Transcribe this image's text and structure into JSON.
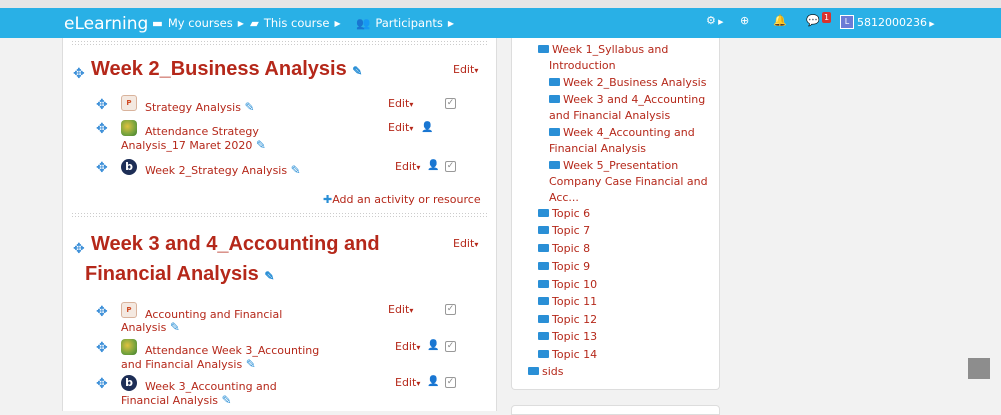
{
  "navbar": {
    "brand": "eLearning",
    "my_courses": "My courses",
    "this_course": "This course",
    "participants": "Participants",
    "messages_badge": "1",
    "user_initial": "L",
    "user_id": "5812000236"
  },
  "sections": [
    {
      "title": "Week 2_Business Analysis",
      "edit_label": "Edit",
      "activities": [
        {
          "name": "Strategy Analysis",
          "edit_label": "Edit",
          "icon": "powerpoint-icon"
        },
        {
          "name_line1": "Attendance Strategy",
          "name_line2": "Analysis_17 Maret 2020",
          "edit_label": "Edit",
          "icon": "attendance-icon"
        },
        {
          "name": "Week 2_Strategy Analysis",
          "edit_label": "Edit",
          "icon": "bigbluebutton-icon"
        }
      ],
      "add_activity": "Add an activity or resource"
    },
    {
      "title_line1": "Week 3 and 4_Accounting and",
      "title_line2": "Financial Analysis",
      "edit_label": "Edit",
      "activities": [
        {
          "name_line1": "Accounting and Financial",
          "name_line2": "Analysis",
          "edit_label": "Edit",
          "icon": "powerpoint-icon"
        },
        {
          "name_line1": "Attendance Week 3_Accounting",
          "name_line2": "and Financial Analysis",
          "edit_label": "Edit",
          "icon": "attendance-icon"
        },
        {
          "name_line1": "Week 3_Accounting and",
          "name_line2": "Financial Analysis",
          "edit_label": "Edit",
          "icon": "bigbluebutton-icon"
        }
      ]
    }
  ],
  "sidebar_tree": [
    {
      "line1": "Week 1_Syllabus and",
      "line2": "Introduction"
    },
    {
      "line1": "Week 2_Business Analysis"
    },
    {
      "line1": "Week 3 and 4_Accounting",
      "line2": "and Financial Analysis"
    },
    {
      "line1": "Week 4_Accounting and",
      "line2": "Financial Analysis"
    },
    {
      "line1": "Week 5_Presentation",
      "line2": "Company Case Financial and",
      "line3": "Acc..."
    },
    {
      "line1": "Topic 6"
    },
    {
      "line1": "Topic 7"
    },
    {
      "line1": "Topic 8"
    },
    {
      "line1": "Topic 9"
    },
    {
      "line1": "Topic 10"
    },
    {
      "line1": "Topic 11"
    },
    {
      "line1": "Topic 12"
    },
    {
      "line1": "Topic 13"
    },
    {
      "line1": "Topic 14"
    },
    {
      "line1": "sids"
    }
  ],
  "colors": {
    "navbar": "#29b0e6",
    "link": "#b5281a",
    "accent": "#2a8fd6"
  }
}
